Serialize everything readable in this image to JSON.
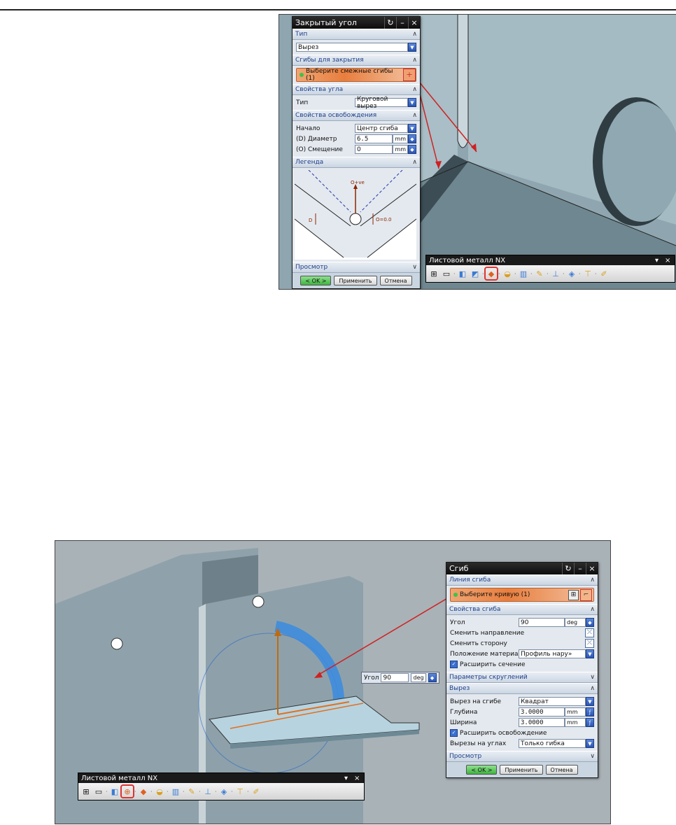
{
  "figure1": {
    "dialog": {
      "title": "Закрытый угол",
      "sec_type": "Тип",
      "type_value": "Вырез",
      "sec_bends": "Сгибы для закрытия",
      "select_bends": "Выберите смежные сгибы (1)",
      "sec_corner": "Свойства угла",
      "corner_type_label": "Тип",
      "corner_type_value": "Круговой вырез",
      "sec_relief": "Свойства освобождения",
      "origin_label": "Начало",
      "origin_value": "Центр сгиба",
      "diameter_label": "(D) Диаметр",
      "diameter_value": "6.5",
      "offset_label": "(O) Смещение",
      "offset_value": "0",
      "unit": "mm",
      "sec_legend": "Легенда",
      "legend_o_plus": "O+ve",
      "legend_d": "D",
      "legend_o_zero": "O=0.0",
      "sec_preview": "Просмотр",
      "ok": "< OK >",
      "apply": "Применить",
      "cancel": "Отмена"
    },
    "toolbar": {
      "title": "Листовой металл NX"
    }
  },
  "figure2": {
    "dialog": {
      "title": "Сгиб",
      "sec_line": "Линия сгиба",
      "select_curve": "Выберите кривую (1)",
      "sec_props": "Свойства сгиба",
      "angle_label": "Угол",
      "angle_value": "90",
      "angle_unit": "deg",
      "flip_dir": "Сменить направление",
      "flip_side": "Сменить сторону",
      "material_label": "Положение материал",
      "material_value": "Профиль нару»",
      "extend_section": "Расширить сечение",
      "sec_round": "Параметры скруглений",
      "sec_relief": "Вырез",
      "relief_label": "Вырез на сгибе",
      "relief_value": "Квадрат",
      "depth_label": "Глубина",
      "depth_value": "3.0000",
      "width_label": "Ширина",
      "width_value": "3.0000",
      "unit": "mm",
      "extend_relief": "Расширить освобождение",
      "corner_label": "Вырезы на углах",
      "corner_value": "Только гибка",
      "sec_preview": "Просмотр",
      "ok": "< OK >",
      "apply": "Применить",
      "cancel": "Отмена"
    },
    "angle_float": {
      "label": "Угол",
      "value": "90",
      "unit": "deg"
    },
    "toolbar": {
      "title": "Листовой металл NX"
    }
  },
  "colors": {
    "accent_select": "#e87e3e",
    "section_text": "#1d3f8a",
    "ok_green": "#3eb43e",
    "model": "#9fb3bb"
  }
}
